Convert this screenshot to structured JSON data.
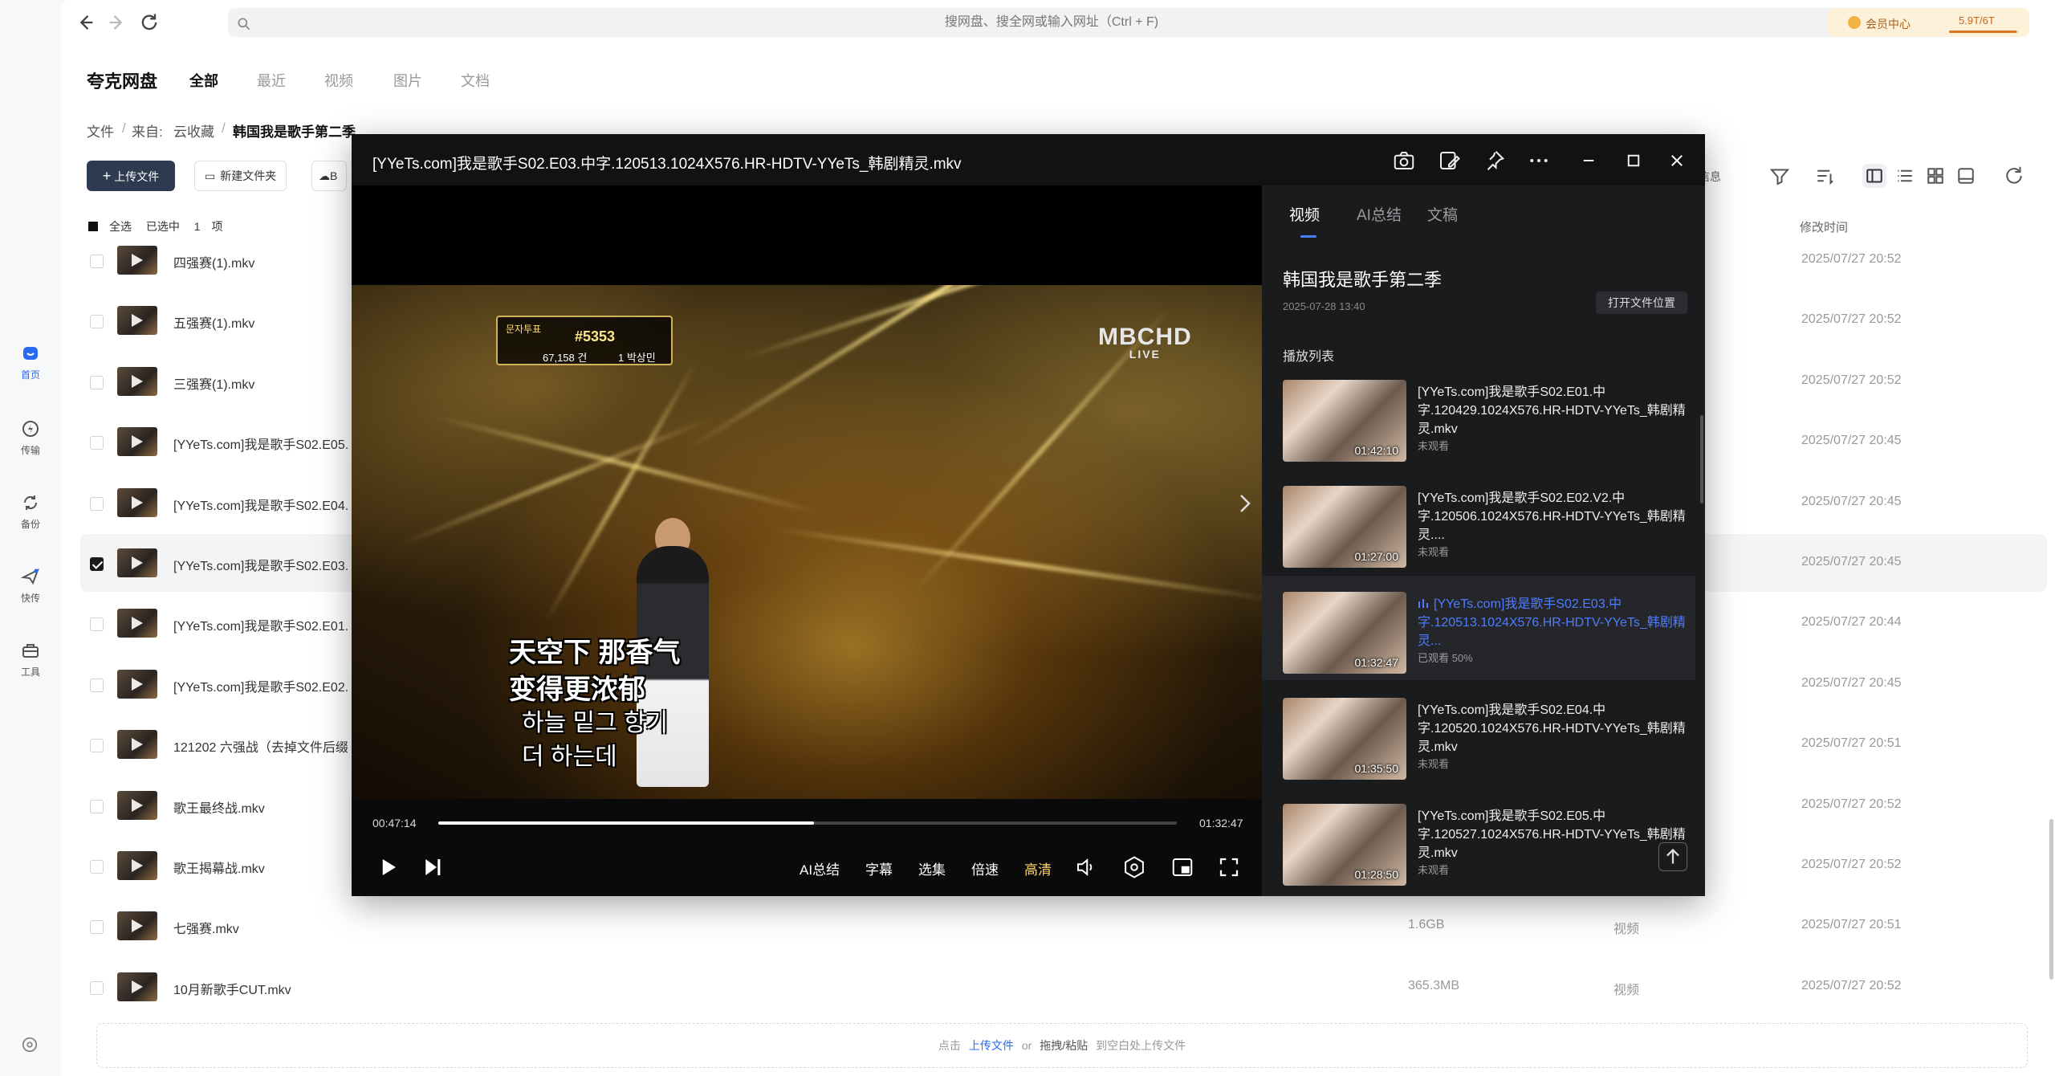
{
  "sidebar": {
    "items": [
      {
        "label": "首页",
        "icon": "home-icon",
        "active": true
      },
      {
        "label": "传输",
        "icon": "transfer-icon",
        "active": false
      },
      {
        "label": "备份",
        "icon": "backup-icon",
        "active": false
      },
      {
        "label": "快传",
        "icon": "quick-send-icon",
        "active": false
      },
      {
        "label": "工具",
        "icon": "tools-icon",
        "active": false
      }
    ],
    "bottom_icon": "settings-icon"
  },
  "topbar": {
    "search_placeholder": "搜网盘、搜全网或输入网址（Ctrl + F)",
    "member_label": "会员中心",
    "quota": "5.9T/6T",
    "quota_fraction": 0.98
  },
  "brand": "夸克网盘",
  "tabs": [
    "全部",
    "最近",
    "视频",
    "图片",
    "文档"
  ],
  "breadcrumb": {
    "items": [
      "文件",
      "来自:",
      "云收藏"
    ],
    "current": "韩国我是歌手第二季"
  },
  "toolbar": {
    "upload": "上传文件",
    "new_folder": "新建文件夹",
    "partial_button": "B",
    "info_partial": "信息"
  },
  "list_header": {
    "select_all": "全选",
    "selected": "已选中",
    "count": "1",
    "unit": "项",
    "modified": "修改时间"
  },
  "files": [
    {
      "name": "四强赛(1).mkv",
      "size": "",
      "type": "",
      "time": "2025/07/27 20:52",
      "checked": false
    },
    {
      "name": "五强赛(1).mkv",
      "size": "",
      "type": "",
      "time": "2025/07/27 20:52",
      "checked": false
    },
    {
      "name": "三强赛(1).mkv",
      "size": "",
      "type": "",
      "time": "2025/07/27 20:52",
      "checked": false
    },
    {
      "name": "[YYeTs.com]我是歌手S02.E05.",
      "size": "",
      "type": "",
      "time": "2025/07/27 20:45",
      "checked": false
    },
    {
      "name": "[YYeTs.com]我是歌手S02.E04.",
      "size": "",
      "type": "",
      "time": "2025/07/27 20:45",
      "checked": false
    },
    {
      "name": "[YYeTs.com]我是歌手S02.E03.",
      "size": "",
      "type": "",
      "time": "2025/07/27 20:45",
      "checked": true
    },
    {
      "name": "[YYeTs.com]我是歌手S02.E01.",
      "size": "",
      "type": "",
      "time": "2025/07/27 20:44",
      "checked": false
    },
    {
      "name": "[YYeTs.com]我是歌手S02.E02.",
      "size": "",
      "type": "",
      "time": "2025/07/27 20:45",
      "checked": false
    },
    {
      "name": "121202 六强战（去掉文件后缀",
      "size": "",
      "type": "",
      "time": "2025/07/27 20:51",
      "checked": false
    },
    {
      "name": "歌王最终战.mkv",
      "size": "",
      "type": "",
      "time": "2025/07/27 20:52",
      "checked": false
    },
    {
      "name": "歌王揭幕战.mkv",
      "size": "",
      "type": "",
      "time": "2025/07/27 20:52",
      "checked": false
    },
    {
      "name": "七强赛.mkv",
      "size": "1.6GB",
      "type": "视频",
      "time": "2025/07/27 20:51",
      "checked": false
    },
    {
      "name": "10月新歌手CUT.mkv",
      "size": "365.3MB",
      "type": "视频",
      "time": "2025/07/27 20:52",
      "checked": false
    }
  ],
  "dropzone": {
    "prefix": "点击",
    "upload_link": "上传文件",
    "or": "or",
    "drag": "拖拽/粘贴",
    "suffix": "到空白处上传文件"
  },
  "player": {
    "title": "[YYeTs.com]我是歌手S02.E03.中字.120513.1024X576.HR-HDTV-YYeTs_韩剧精灵.mkv",
    "video": {
      "logo": "MBCHD",
      "logo_sub": "LIVE",
      "score_label": "문자투표",
      "score_number": "#5353",
      "score_votes": "67,158 건",
      "score_rank": "1 박상민",
      "subtitles": [
        "天空下 那香气",
        "变得更浓郁",
        "하늘 밑그 향기",
        "더 하는데"
      ]
    },
    "time_current": "00:47:14",
    "time_total": "01:32:47",
    "progress_fraction": 0.509,
    "controls": {
      "ai": "AI总结",
      "subtitle": "字幕",
      "episodes": "选集",
      "speed": "倍速",
      "quality": "高清"
    },
    "panel": {
      "tabs": [
        "视频",
        "AI总结",
        "文稿"
      ],
      "title": "韩国我是歌手第二季",
      "date": "2025-07-28 13:40",
      "open_location": "打开文件位置",
      "playlist_label": "播放列表",
      "playlist": [
        {
          "name": "[YYeTs.com]我是歌手S02.E01.中字.120429.1024X576.HR-HDTV-YYeTs_韩剧精灵.mkv",
          "duration": "01:42:10",
          "status": "未观看",
          "current": false
        },
        {
          "name": "[YYeTs.com]我是歌手S02.E02.V2.中字.120506.1024X576.HR-HDTV-YYeTs_韩剧精灵....",
          "duration": "01:27:00",
          "status": "未观看",
          "current": false
        },
        {
          "name": "[YYeTs.com]我是歌手S02.E03.中字.120513.1024X576.HR-HDTV-YYeTs_韩剧精灵...",
          "duration": "01:32:47",
          "status": "已观看 50%",
          "current": true
        },
        {
          "name": "[YYeTs.com]我是歌手S02.E04.中字.120520.1024X576.HR-HDTV-YYeTs_韩剧精灵.mkv",
          "duration": "01:35:50",
          "status": "未观看",
          "current": false
        },
        {
          "name": "[YYeTs.com]我是歌手S02.E05.中字.120527.1024X576.HR-HDTV-YYeTs_韩剧精灵.mkv",
          "duration": "01:28:50",
          "status": "未观看",
          "current": false
        }
      ]
    }
  },
  "colors": {
    "accent": "#2a6bf2",
    "player_accent": "#4d7cff",
    "hd_gold": "#ffd36b",
    "upload_button": "#2d3a4f"
  }
}
